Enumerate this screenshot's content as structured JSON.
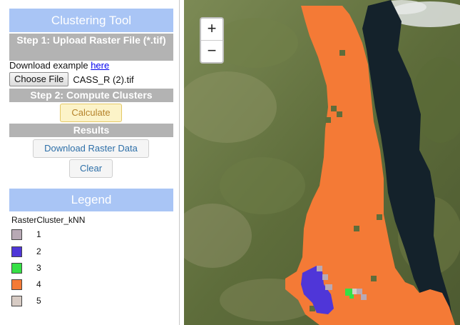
{
  "app": {
    "title": "Clustering Tool",
    "step1": "Step 1: Upload Raster File (*.tif)",
    "download_prefix": "Download example ",
    "download_link": "here",
    "choose_file": "Choose File",
    "file_name": "CASS_R (2).tif",
    "step2": "Step 2: Compute Clusters",
    "calculate": "Calculate",
    "results": "Results",
    "download_raster": "Download Raster Data",
    "clear": "Clear"
  },
  "legend": {
    "title": "Legend",
    "layer": "RasterCluster_kNN",
    "items": [
      {
        "label": "1",
        "color": "#b8a9b5"
      },
      {
        "label": "2",
        "color": "#4f36d8"
      },
      {
        "label": "3",
        "color": "#35e045"
      },
      {
        "label": "4",
        "color": "#f47a36"
      },
      {
        "label": "5",
        "color": "#d7cbc4"
      }
    ]
  },
  "map": {
    "zoom_in": "+",
    "zoom_out": "−"
  }
}
